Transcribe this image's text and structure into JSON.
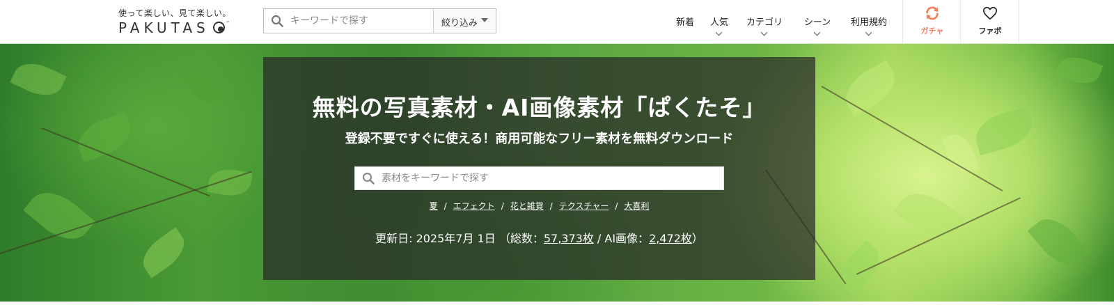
{
  "header": {
    "logo": {
      "tagline": "使って楽しい、見て楽しい。",
      "wordmark": "PAKUTAS",
      "trademark": "™"
    },
    "search": {
      "placeholder": "キーワードで探す",
      "filter_label": "絞り込み"
    },
    "nav": [
      {
        "label": "新着",
        "has_dropdown": false
      },
      {
        "label": "人気",
        "has_dropdown": true
      },
      {
        "label": "カテゴリ",
        "has_dropdown": true
      },
      {
        "label": "シーン",
        "has_dropdown": true
      },
      {
        "label": "利用規約",
        "has_dropdown": true
      }
    ],
    "gacha": {
      "label": "ガチャ",
      "icon": "refresh-icon",
      "color": "#f08262"
    },
    "favorites": {
      "label": "ファボ",
      "icon": "heart-icon"
    }
  },
  "hero": {
    "title": "無料の写真素材・AI画像素材「ぱくたそ」",
    "subtitle": "登録不要ですぐに使える！商用可能なフリー素材を無料ダウンロード",
    "search": {
      "placeholder": "素材をキーワードで探す"
    },
    "tags": [
      "夏",
      "エフェクト",
      "花と雑貨",
      "テクスチャー",
      "大喜利"
    ],
    "tag_separator": "/",
    "stats": {
      "prefix": "更新日: 2025年7月 1日 （総数：",
      "total": "57,373枚",
      "middle": " / AI画像：",
      "ai_total": "2,472枚",
      "suffix": "）"
    }
  }
}
